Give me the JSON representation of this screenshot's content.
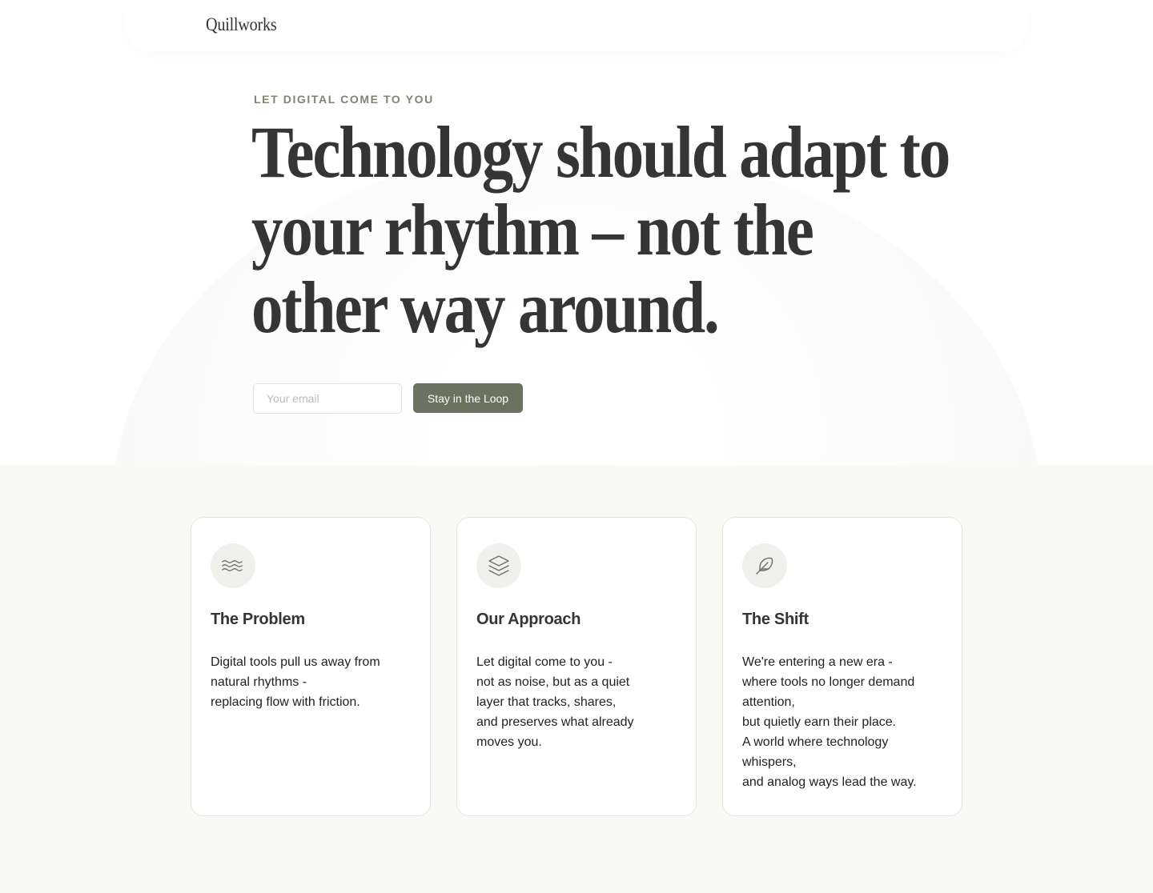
{
  "header": {
    "logo": "Quillworks"
  },
  "hero": {
    "eyebrow": "LET DIGITAL COME TO YOU",
    "headline_lines": [
      "Technology should adapt to",
      "your rhythm – not the",
      "other way around."
    ],
    "email_placeholder": "Your email",
    "email_value": "",
    "cta_label": "Stay in the Loop"
  },
  "features": {
    "cards": [
      {
        "icon": "waves-icon",
        "title": "The Problem",
        "body_lines": [
          "Digital tools pull us away from",
          "natural rhythms -",
          "replacing flow with friction."
        ]
      },
      {
        "icon": "layers-icon",
        "title": "Our Approach",
        "body_lines": [
          "Let digital come to you -",
          "not as noise, but as a quiet",
          "layer that tracks, shares,",
          "and preserves what already",
          "moves you."
        ]
      },
      {
        "icon": "feather-icon",
        "title": "The Shift",
        "body_lines": [
          "We're entering a new era -",
          "where tools no longer demand",
          "attention,",
          "but quietly earn their place.",
          "A world where technology",
          "whispers,",
          "and analog ways lead the way."
        ]
      }
    ]
  },
  "colors": {
    "accent": "#6b7260",
    "eyebrow": "#7f8473",
    "headline": "#353535",
    "section_background": "#f9f9f5",
    "icon_stroke": "#6e6e6e"
  }
}
